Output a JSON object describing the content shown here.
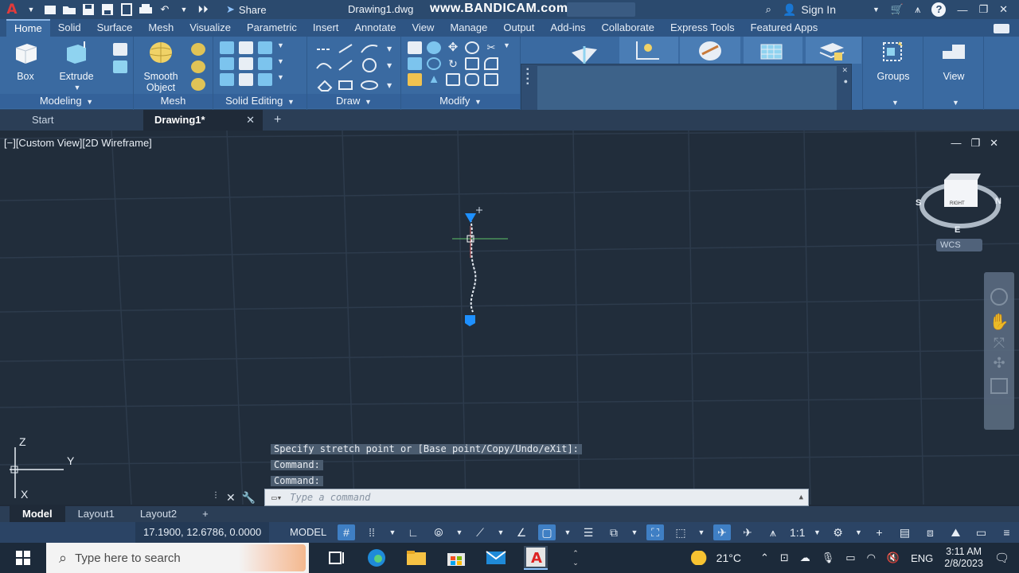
{
  "titlebar": {
    "share_label": "Share",
    "filename": "Drawing1.dwg",
    "watermark": "www.BANDICAM.com",
    "signin_label": "Sign In"
  },
  "ribbon_tabs": [
    "Home",
    "Solid",
    "Surface",
    "Mesh",
    "Visualize",
    "Parametric",
    "Insert",
    "Annotate",
    "View",
    "Manage",
    "Output",
    "Add-ins",
    "Collaborate",
    "Express Tools",
    "Featured Apps"
  ],
  "ribbon": {
    "modeling": {
      "label": "Modeling",
      "box": "Box",
      "extrude": "Extrude"
    },
    "mesh": {
      "label": "Mesh",
      "smooth_object": "Smooth Object"
    },
    "solid_editing": {
      "label": "Solid Editing"
    },
    "draw": {
      "label": "Draw"
    },
    "modify": {
      "label": "Modify"
    },
    "groups": {
      "label": "Groups"
    },
    "view": {
      "label": "View"
    }
  },
  "doc_tabs": {
    "start": "Start",
    "active": "Drawing1*"
  },
  "viewport": {
    "view_label": "[−][Custom View][2D Wireframe]",
    "viewcube_face": "RIGHT",
    "compass": {
      "s": "S",
      "n": "N",
      "e": "E"
    },
    "wcs": "WCS",
    "ucs": {
      "z": "Z",
      "y": "Y",
      "x": "X"
    }
  },
  "command_history": [
    "Specify stretch point or [Base point/Copy/Undo/eXit]:",
    "Command:",
    "Command:"
  ],
  "command_input": {
    "placeholder": "Type a command"
  },
  "layout_tabs": [
    "Model",
    "Layout1",
    "Layout2"
  ],
  "statusbar": {
    "coords": "17.1900, 12.6786, 0.0000",
    "model": "MODEL",
    "scale": "1:1"
  },
  "taskbar": {
    "search_placeholder": "Type here to search",
    "weather": "21°C",
    "lang": "ENG",
    "time": "3:11 AM",
    "date": "2/8/2023"
  }
}
